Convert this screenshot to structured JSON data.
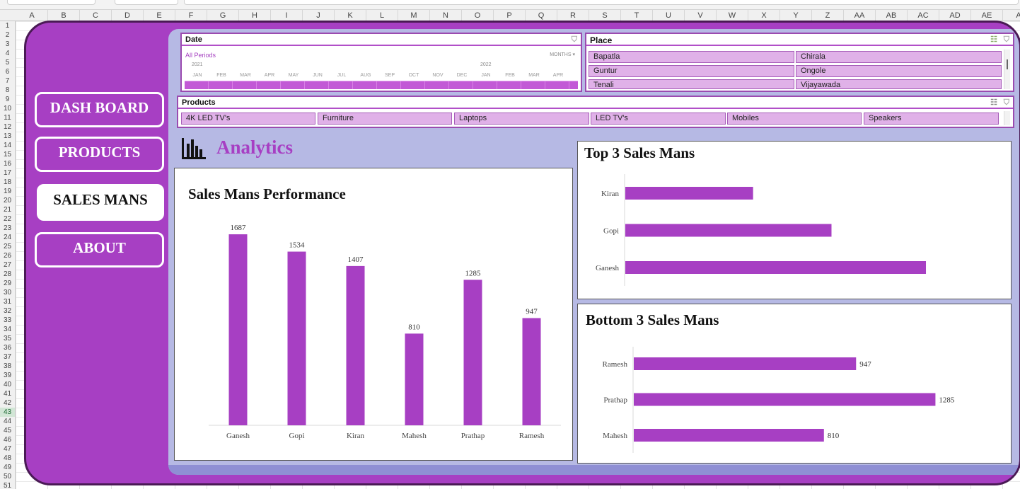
{
  "spreadsheet": {
    "columns": [
      "A",
      "B",
      "C",
      "D",
      "E",
      "F",
      "G",
      "H",
      "I",
      "J",
      "K",
      "L",
      "M",
      "N",
      "O",
      "P",
      "Q",
      "R",
      "S",
      "T",
      "U",
      "V",
      "W",
      "X",
      "Y",
      "Z",
      "AA",
      "AB",
      "AC",
      "AD",
      "AE",
      "A"
    ],
    "rows": [
      "1",
      "2",
      "3",
      "4",
      "5",
      "6",
      "7",
      "8",
      "9",
      "10",
      "11",
      "12",
      "13",
      "14",
      "15",
      "16",
      "17",
      "18",
      "19",
      "20",
      "21",
      "22",
      "23",
      "24",
      "25",
      "26",
      "27",
      "28",
      "29",
      "30",
      "31",
      "32",
      "33",
      "34",
      "35",
      "36",
      "37",
      "38",
      "39",
      "40",
      "41",
      "42",
      "43",
      "44",
      "45",
      "46",
      "47",
      "48",
      "49",
      "50",
      "51"
    ],
    "selected_row": "43"
  },
  "nav": {
    "items": [
      {
        "label": "DASH BOARD",
        "active": false
      },
      {
        "label": "PRODUCTS",
        "active": false
      },
      {
        "label": "SALES MANS",
        "active": true
      },
      {
        "label": "ABOUT",
        "active": false
      }
    ]
  },
  "slicers": {
    "date": {
      "title": "Date",
      "all_periods": "All Periods",
      "granularity": "MONTHS",
      "years": [
        "2021",
        "2022"
      ],
      "months": [
        "JAN",
        "FEB",
        "MAR",
        "APR",
        "MAY",
        "JUN",
        "JUL",
        "AUG",
        "SEP",
        "OCT",
        "NOV",
        "DEC",
        "JAN",
        "FEB",
        "MAR",
        "APR"
      ]
    },
    "place": {
      "title": "Place",
      "items": [
        "Bapatla",
        "Chirala",
        "Guntur",
        "Ongole",
        "Tenali",
        "Vijayawada"
      ]
    },
    "products": {
      "title": "Products",
      "items": [
        "4K LED TV's",
        "Furniture",
        "Laptops",
        "LED TV's",
        "Mobiles",
        "Speakers"
      ]
    }
  },
  "analytics_label": "Analytics",
  "colors": {
    "bar": "#a73fc3",
    "dashboard": "#a73fc3",
    "content_bg": "#b6b9e4"
  },
  "chart_data": [
    {
      "type": "bar",
      "title": "Sales Mans Performance",
      "categories": [
        "Ganesh",
        "Gopi",
        "Kiran",
        "Mahesh",
        "Prathap",
        "Ramesh"
      ],
      "values": [
        1687,
        1534,
        1407,
        810,
        1285,
        947
      ],
      "ylim": [
        0,
        1800
      ],
      "data_labels": true,
      "grid": false
    },
    {
      "type": "bar",
      "orientation": "horizontal",
      "title": "Top 3 Sales Mans",
      "categories": [
        "Kiran",
        "Gopi",
        "Ganesh"
      ],
      "values": [
        1407,
        1534,
        1687
      ],
      "xlim": [
        1200,
        1750
      ],
      "data_labels": false,
      "grid": false
    },
    {
      "type": "bar",
      "orientation": "horizontal",
      "title": "Bottom 3 Sales Mans",
      "categories": [
        "Ramesh",
        "Prathap",
        "Mahesh"
      ],
      "values": [
        947,
        1285,
        810
      ],
      "xlim": [
        0,
        1350
      ],
      "data_labels": true,
      "grid": false
    }
  ]
}
